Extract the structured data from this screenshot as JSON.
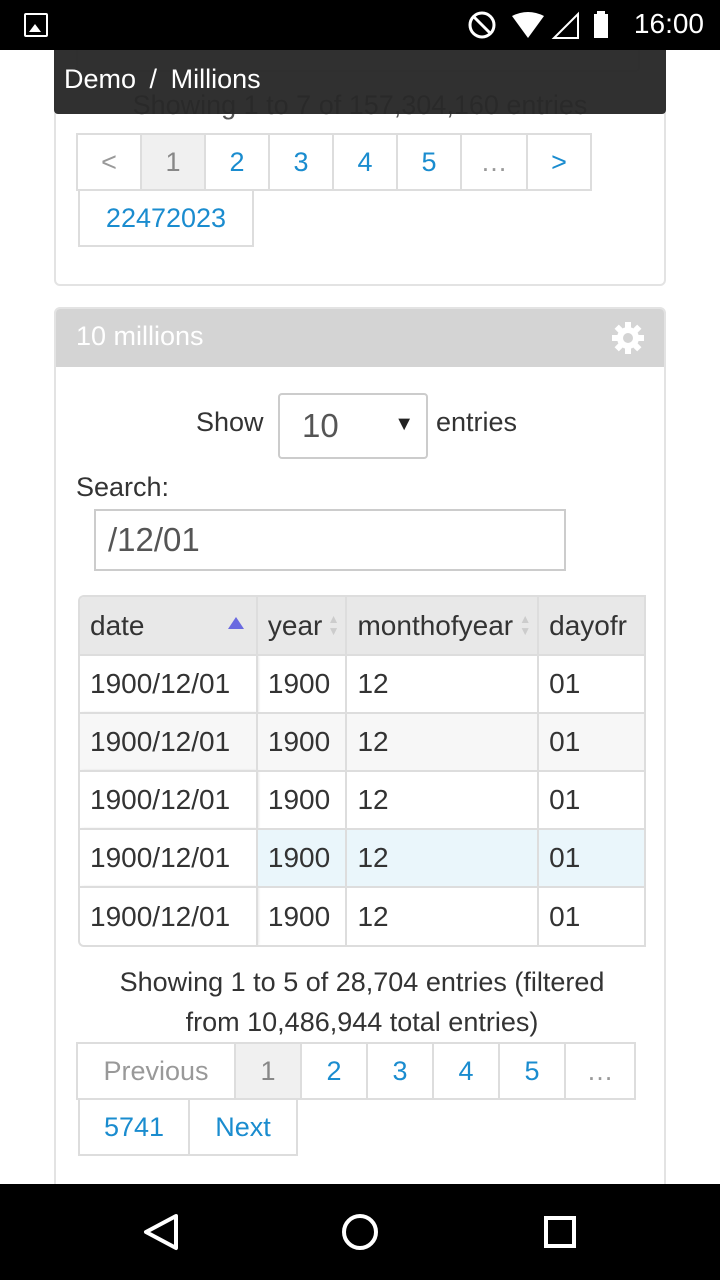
{
  "statusbar": {
    "time": "16:00"
  },
  "breadcrumb": {
    "root": "Demo",
    "separator": "/",
    "current": "Millions"
  },
  "top_panel": {
    "info": "Showing 1 to 7 of 157,304,160 entries",
    "pages": [
      "<",
      "1",
      "2",
      "3",
      "4",
      "5",
      "…",
      ">"
    ],
    "last_page": "22472023"
  },
  "panel": {
    "title": "10 millions",
    "show_label": "Show",
    "entries_label": "entries",
    "length_value": "10",
    "search_label": "Search:",
    "search_value": "/12/01",
    "columns": [
      "date",
      "year",
      "monthofyear",
      "dayofr"
    ],
    "rows": [
      [
        "1900/12/01",
        "1900",
        "12",
        "01"
      ],
      [
        "1900/12/01",
        "1900",
        "12",
        "01"
      ],
      [
        "1900/12/01",
        "1900",
        "12",
        "01"
      ],
      [
        "1900/12/01",
        "1900",
        "12",
        "01"
      ],
      [
        "1900/12/01",
        "1900",
        "12",
        "01"
      ]
    ],
    "info_line1": "Showing 1 to 5 of 28,704 entries (filtered",
    "info_line2": "from 10,486,944 total entries)",
    "pager": {
      "previous": "Previous",
      "pages": [
        "1",
        "2",
        "3",
        "4",
        "5",
        "…"
      ],
      "last": "5741",
      "next": "Next"
    }
  }
}
